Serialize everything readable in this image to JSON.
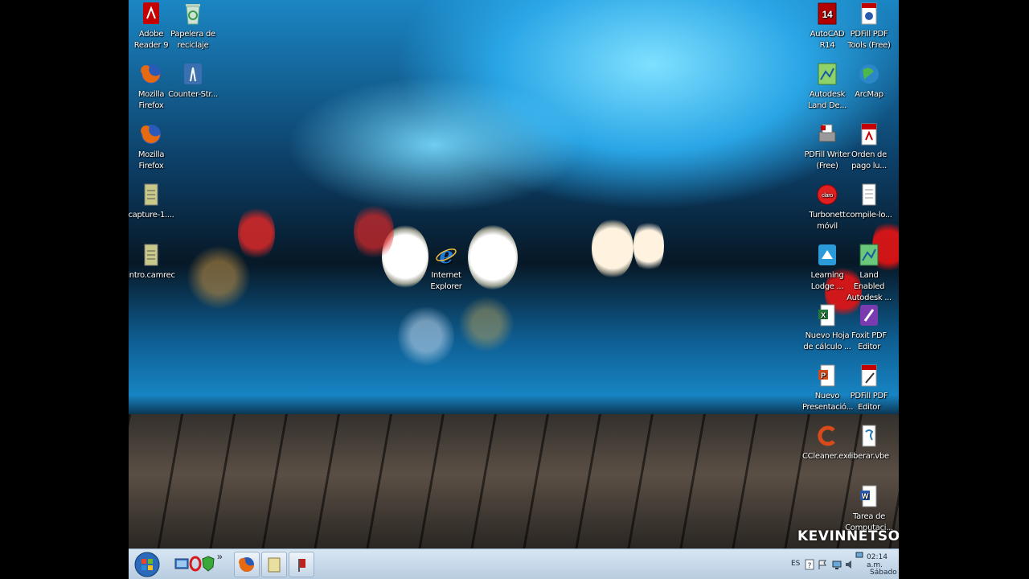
{
  "desktop": {
    "left_icons": [
      {
        "name": "adobe-reader-icon",
        "label": "Adobe\nReader 9",
        "icon": "pdf-icon",
        "color": "#c40000"
      },
      {
        "name": "recycle-bin-icon",
        "label": "Papelera de\nreciclaje",
        "icon": "recycle-bin-icon",
        "color": "#5a9"
      },
      {
        "name": "firefox-icon-1",
        "label": "Mozilla\nFirefox",
        "icon": "firefox-icon",
        "color": "#e76a10"
      },
      {
        "name": "counter-strike-icon",
        "label": "Counter-Str...",
        "icon": "game-icon",
        "color": "#3a6fb0"
      },
      {
        "name": "firefox-icon-2",
        "label": "Mozilla\nFirefox",
        "icon": "firefox-icon",
        "color": "#e76a10"
      },
      {
        "name": "capture-file-icon",
        "label": "capture-1....",
        "icon": "file-icon",
        "color": "#9b9b5a"
      },
      {
        "name": "intro-camrec-icon",
        "label": "intro.camrec",
        "icon": "file-icon",
        "color": "#9b9b5a"
      },
      {
        "name": "internet-explorer-icon",
        "label": "Internet\nExplorer",
        "icon": "ie-icon",
        "color": "#1e78d6"
      }
    ],
    "right_icons": [
      {
        "name": "autocad-icon",
        "label": "AutoCAD\nR14",
        "icon": "autocad-icon",
        "color": "#b30000"
      },
      {
        "name": "pdffill-tools-icon",
        "label": "PDFill PDF\nTools (Free)",
        "icon": "pdf-icon",
        "color": "#c40000"
      },
      {
        "name": "autodesk-land-icon",
        "label": "Autodesk\nLand De...",
        "icon": "map-icon",
        "color": "#6cb84a"
      },
      {
        "name": "arcmap-icon",
        "label": "ArcMap",
        "icon": "globe-icon",
        "color": "#2c86c8"
      },
      {
        "name": "pdffill-writer-icon",
        "label": "PDFill Writer\n(Free)",
        "icon": "printer-icon",
        "color": "#888"
      },
      {
        "name": "orden-de-pago-icon",
        "label": "Orden de\npago lu...",
        "icon": "pdf-icon",
        "color": "#c40000"
      },
      {
        "name": "turbonett-icon",
        "label": "Turbonett\nmóvil",
        "icon": "claro-icon",
        "color": "#e02020"
      },
      {
        "name": "compile-log-icon",
        "label": "compile-lo...",
        "icon": "document-icon",
        "color": "#ddd"
      },
      {
        "name": "learning-lodge-icon",
        "label": "Learning\nLodge ...",
        "icon": "app-icon",
        "color": "#2a9ad8"
      },
      {
        "name": "land-enabled-icon",
        "label": "Land Enabled\nAutodesk ...",
        "icon": "map-icon",
        "color": "#4aa85a"
      },
      {
        "name": "nuevo-hoja-icon",
        "label": "Nuevo Hoja\nde cálculo ...",
        "icon": "excel-icon",
        "color": "#1f7a3a"
      },
      {
        "name": "foxit-editor-icon",
        "label": "Foxit PDF\nEditor",
        "icon": "foxit-icon",
        "color": "#7a3ab0"
      },
      {
        "name": "nuevo-presentacion-icon",
        "label": "Nuevo\nPresentació...",
        "icon": "powerpoint-icon",
        "color": "#d24a1a"
      },
      {
        "name": "pdffill-editor-icon",
        "label": "PDFill PDF\nEditor",
        "icon": "pdf-icon",
        "color": "#c40000"
      },
      {
        "name": "ccleaner-icon",
        "label": "CCleaner.exe",
        "icon": "ccleaner-icon",
        "color": "#d84a1a"
      },
      {
        "name": "liberar-vbe-icon",
        "label": "liberar.vbe",
        "icon": "script-icon",
        "color": "#2a7ab0"
      },
      {
        "name": "tarea-computacion-icon",
        "label": "Tarea de\nComputaci...",
        "icon": "word-icon",
        "color": "#2a5ab0"
      }
    ],
    "watermark": "KEVINNETSO"
  },
  "taskbar": {
    "start_label": "Start",
    "quick_launch": [
      {
        "name": "show-desktop-icon",
        "icon": "show-desktop-icon"
      },
      {
        "name": "opera-icon",
        "icon": "opera-icon"
      },
      {
        "name": "quick-launch-3-icon",
        "icon": "shield-icon"
      }
    ],
    "overflow": "»",
    "pinned": [
      {
        "name": "taskbar-firefox-button",
        "icon": "firefox-icon"
      },
      {
        "name": "taskbar-explorer-button",
        "icon": "folder-icon"
      },
      {
        "name": "taskbar-app-button",
        "icon": "app-icon"
      }
    ],
    "tray": {
      "language": "ES",
      "time": "02:14 a.m.",
      "day": "Sábado"
    }
  }
}
